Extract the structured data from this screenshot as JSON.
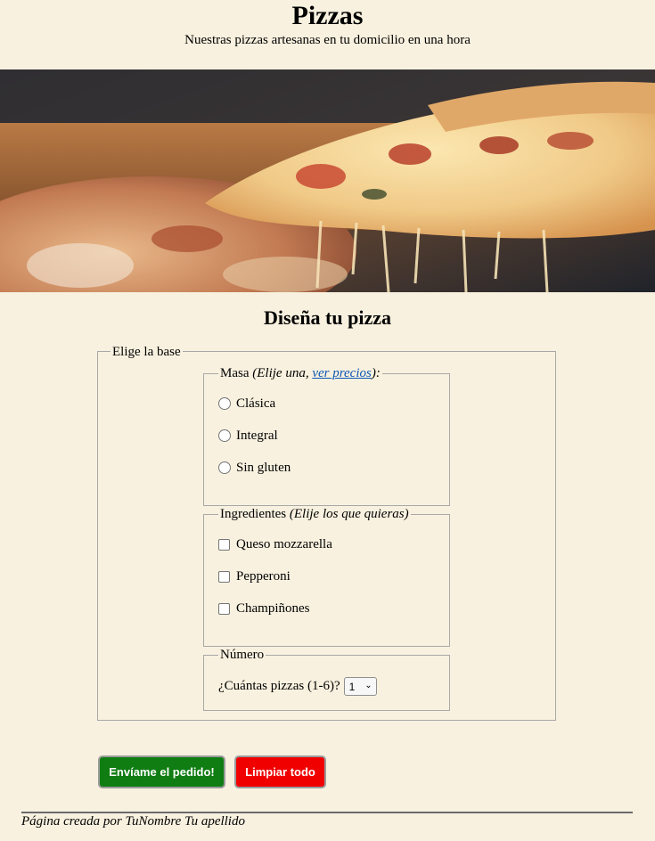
{
  "header": {
    "title": "Pizzas",
    "subtitle": "Nuestras pizzas artesanas en tu domicilio en una hora"
  },
  "hero": {
    "image_description": "pizza-slice-photo"
  },
  "form": {
    "title": "Diseña tu pizza",
    "base_legend": "Elige la base",
    "masa": {
      "legend": "Masa",
      "legend_note": "(Elije una, ",
      "legend_link": "ver precios",
      "legend_end": "):",
      "options": [
        "Clásica",
        "Integral",
        "Sin gluten"
      ]
    },
    "ingredientes": {
      "legend": "Ingredientes",
      "legend_note": "(Elije los que quieras)",
      "options": [
        "Queso mozzarella",
        "Pepperoni",
        "Champiñones"
      ]
    },
    "numero": {
      "legend": "Número",
      "question": "¿Cuántas pizzas (1-6)?",
      "selected": "1"
    }
  },
  "buttons": {
    "send": "Envíame el pedido!",
    "clear": "Limpiar todo"
  },
  "footer": {
    "text": "Página creada por TuNombre Tu apellido"
  },
  "colors": {
    "background": "#f8f1df",
    "send_button": "#0f7d12",
    "clear_button": "#f10000",
    "link": "#0b55b5"
  }
}
